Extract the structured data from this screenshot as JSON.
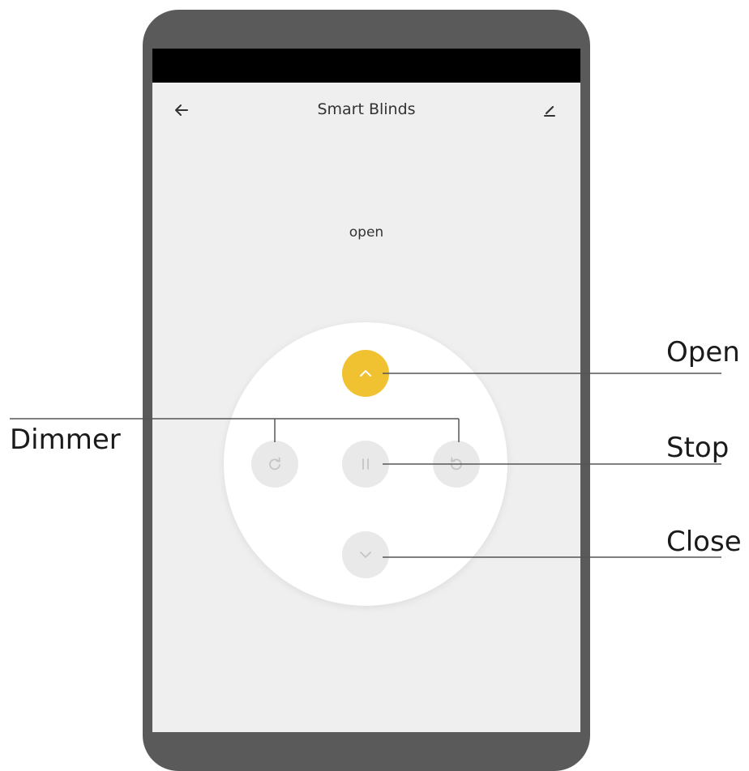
{
  "app": {
    "title": "Smart Blinds",
    "state_text": "open"
  },
  "topbar": {
    "back_icon": "arrow-left-icon",
    "edit_icon": "pencil-icon"
  },
  "controls": {
    "open_icon": "chevron-up-icon",
    "dimmer_left_icon": "rotate-clockwise-icon",
    "stop_icon": "pause-icon",
    "dimmer_right_icon": "rotate-counterclockwise-icon",
    "close_icon": "chevron-down-icon"
  },
  "callouts": {
    "open": "Open",
    "dimmer": "Dimmer",
    "stop": "Stop",
    "close": "Close"
  },
  "colors": {
    "accent": "#f0c232",
    "phone_frame": "#5a5a5a",
    "screen_bg": "#efefef"
  }
}
